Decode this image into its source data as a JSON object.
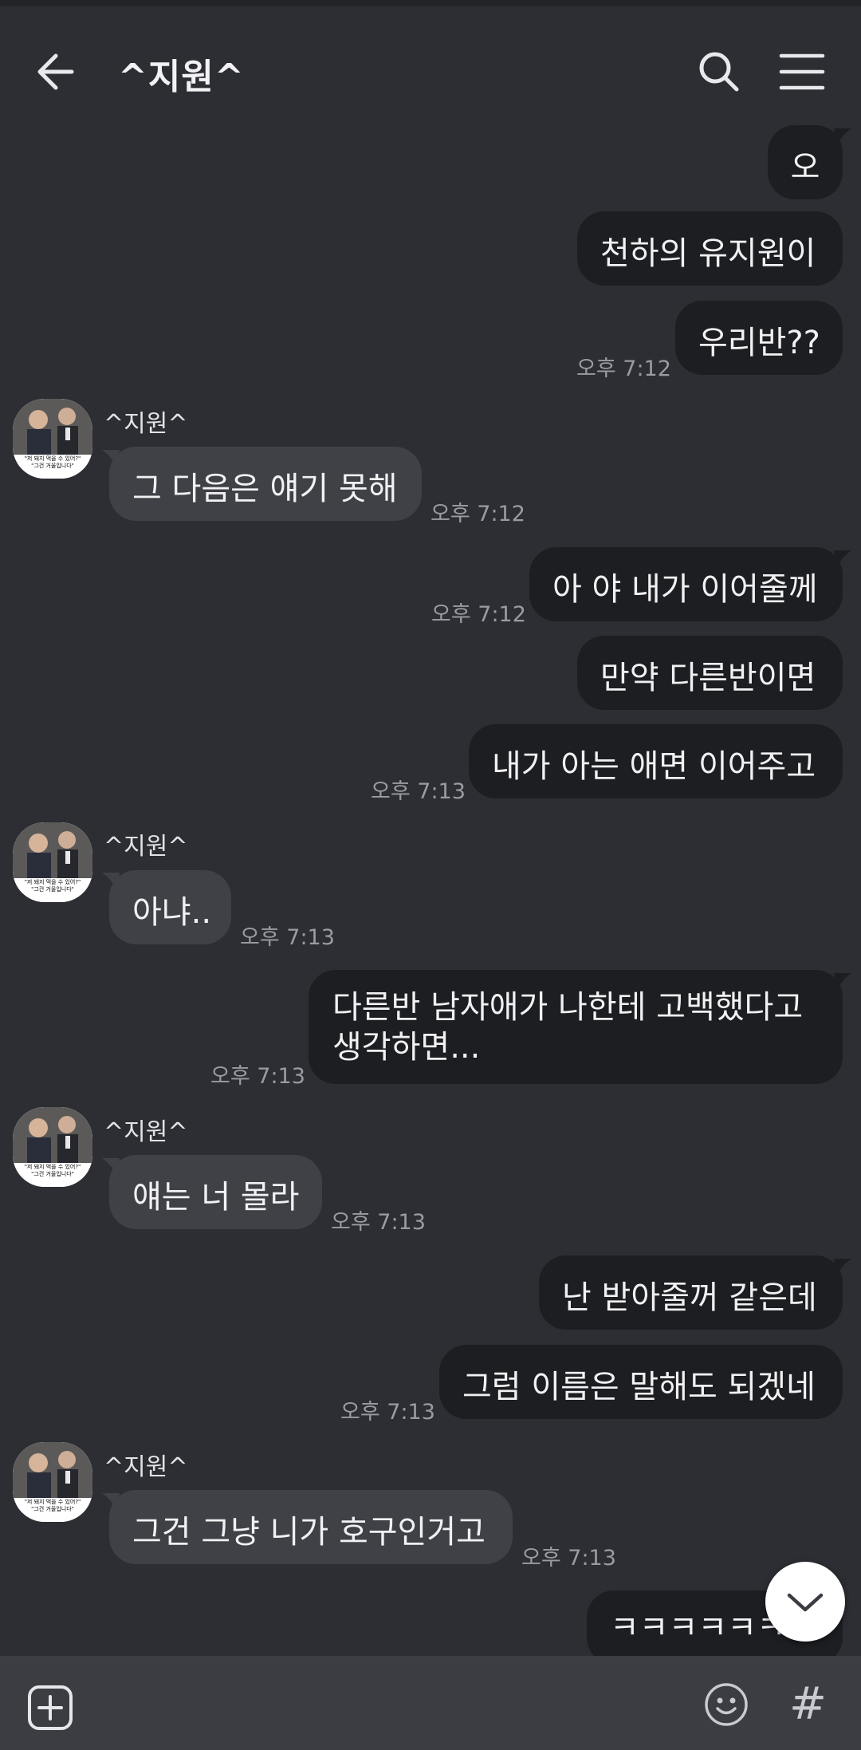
{
  "header": {
    "title": "^지원^",
    "back_icon": "arrow-left-icon",
    "search_icon": "search-icon",
    "menu_icon": "hamburger-menu-icon"
  },
  "contact": {
    "name": "^지원^",
    "avatar_caption": [
      "\"저 돼지 먹을 수 있어?\"",
      "\"그건 거울입니다\""
    ]
  },
  "messages": [
    {
      "side": "out",
      "text": "오"
    },
    {
      "side": "out",
      "text": "천하의 유지원이"
    },
    {
      "side": "out",
      "text": "우리반??",
      "time": "오후 7:12"
    },
    {
      "side": "in",
      "sender": "^지원^",
      "text": "그 다음은 얘기 못해",
      "time": "오후 7:12"
    },
    {
      "side": "out",
      "text": "아 야 내가 이어줄께",
      "time": "오후 7:12"
    },
    {
      "side": "out",
      "text": "만약 다른반이면"
    },
    {
      "side": "out",
      "text": "내가 아는 애면 이어주고",
      "time": "오후 7:13"
    },
    {
      "side": "in",
      "sender": "^지원^",
      "text": "아냐..",
      "time": "오후 7:13"
    },
    {
      "side": "out",
      "text": "다른반 남자애가 나한테 고백했다고 생각하면...",
      "time": "오후 7:13"
    },
    {
      "side": "in",
      "sender": "^지원^",
      "text": "얘는 너 몰라",
      "time": "오후 7:13"
    },
    {
      "side": "out",
      "text": "난 받아줄꺼 같은데"
    },
    {
      "side": "out",
      "text": "그럼 이름은 말해도 되겠네",
      "time": "오후 7:13"
    },
    {
      "side": "in",
      "sender": "^지원^",
      "text": "그건 그냥 니가 호구인거고",
      "time": "오후 7:13"
    },
    {
      "side": "out",
      "text": "ㅋㅋㅋㅋㅋㅋㅋ"
    }
  ],
  "bottom": {
    "plus_icon": "plus-square-icon",
    "emoji_icon": "smiley-icon",
    "hash_label": "#"
  },
  "scroll_down_icon": "chevron-down-icon",
  "colors": {
    "background": "#2c2e33",
    "bubble_out": "#1d1e22",
    "bubble_in": "#3f4147",
    "timestamp": "#9a9ca3",
    "bottombar": "#3b3d43"
  }
}
